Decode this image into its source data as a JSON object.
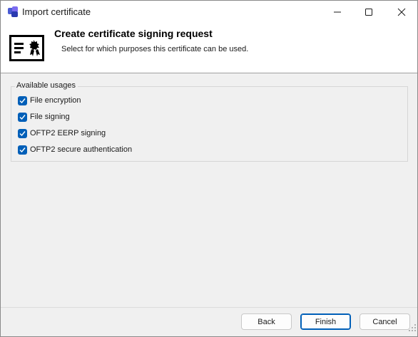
{
  "window": {
    "title": "Import certificate",
    "accent_color": "#005fb8"
  },
  "titlebar_buttons": {
    "minimize_icon": "minimize-icon",
    "maximize_icon": "maximize-icon",
    "close_icon": "close-icon"
  },
  "header": {
    "title": "Create certificate signing request",
    "subtitle": "Select for which purposes this certificate can be used.",
    "icon": "certificate-icon"
  },
  "usages": {
    "legend": "Available usages",
    "items": [
      {
        "label": "File encryption",
        "checked": true
      },
      {
        "label": "File signing",
        "checked": true
      },
      {
        "label": "OFTP2 EERP signing",
        "checked": true
      },
      {
        "label": "OFTP2 secure authentication",
        "checked": true
      }
    ]
  },
  "footer": {
    "back_label": "Back",
    "finish_label": "Finish",
    "cancel_label": "Cancel"
  }
}
